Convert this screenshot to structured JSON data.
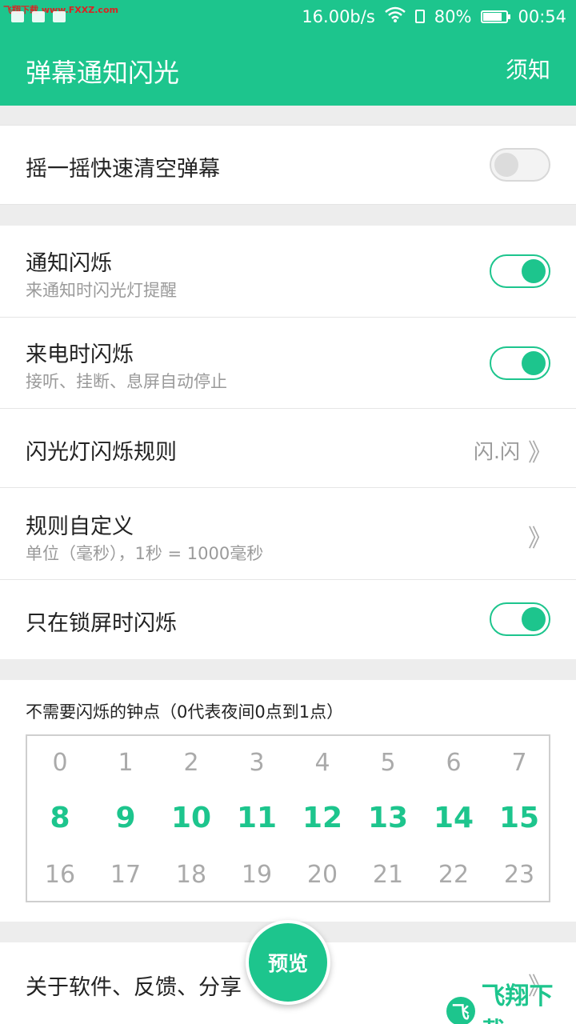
{
  "status_bar": {
    "watermark": "飞翔下载 www.FXXZ.com",
    "network_speed": "16.00b/s",
    "battery_percent": "80%",
    "time": "00:54",
    "battery_level": 0.8
  },
  "app_bar": {
    "title": "弹幕通知闪光",
    "action": "须知"
  },
  "settings": {
    "shake_clear": {
      "label": "摇一摇快速清空弹幕",
      "enabled": false
    },
    "notify_flash": {
      "label": "通知闪烁",
      "sub": "来通知时闪光灯提醒",
      "enabled": true
    },
    "call_flash": {
      "label": "来电时闪烁",
      "sub": "接听、挂断、息屏自动停止",
      "enabled": true
    },
    "flash_rule": {
      "label": "闪光灯闪烁规则",
      "value": "闪.闪",
      "chevron": "》"
    },
    "custom_rule": {
      "label": "规则自定义",
      "sub": "单位（毫秒），1秒 = 1000毫秒",
      "chevron": "》"
    },
    "lock_only": {
      "label": "只在锁屏时闪烁",
      "enabled": true
    }
  },
  "hours_section": {
    "title": "不需要闪烁的钟点（0代表夜间0点到1点）",
    "hours": [
      "0",
      "1",
      "2",
      "3",
      "4",
      "5",
      "6",
      "7",
      "8",
      "9",
      "10",
      "11",
      "12",
      "13",
      "14",
      "15",
      "16",
      "17",
      "18",
      "19",
      "20",
      "21",
      "22",
      "23"
    ],
    "active": [
      "8",
      "9",
      "10",
      "11",
      "12",
      "13",
      "14",
      "15"
    ]
  },
  "about_row": {
    "label": "关于软件、反馈、分享",
    "chevron": "》"
  },
  "fab": {
    "label": "预览"
  },
  "brand": {
    "text": "飞翔下载"
  },
  "colors": {
    "accent": "#1dc58d"
  }
}
